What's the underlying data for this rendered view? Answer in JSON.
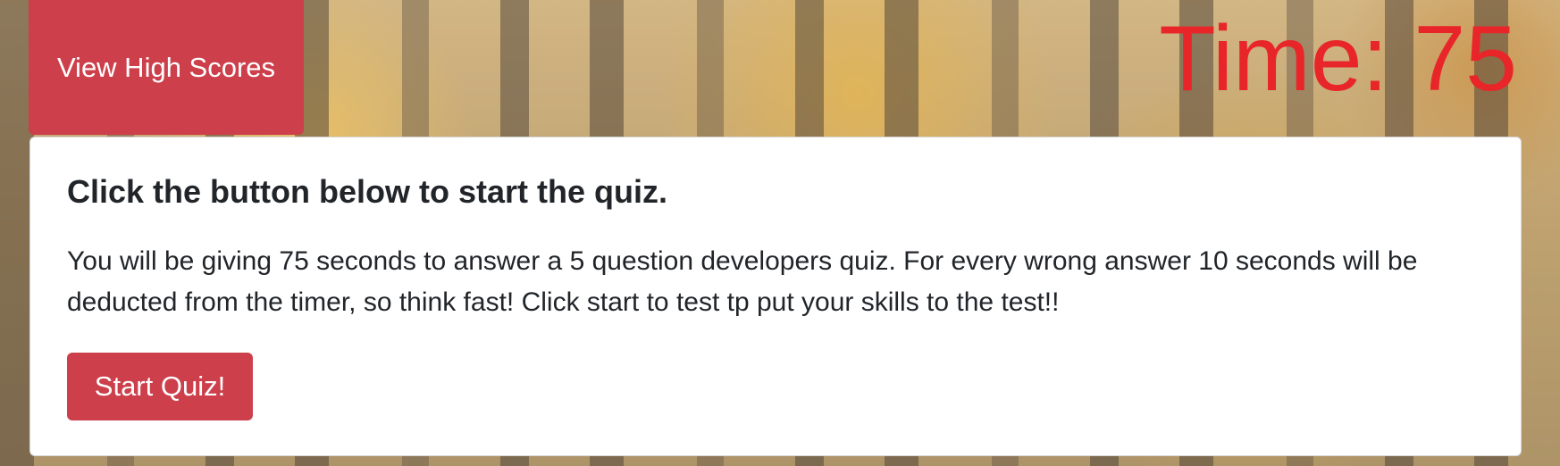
{
  "header": {
    "high_scores_label": "View High Scores",
    "timer_text": "Time: 75"
  },
  "card": {
    "title": "Click the button below to start the quiz.",
    "description": "You will be giving 75 seconds to answer a 5 question developers quiz. For every wrong answer 10 seconds will be deducted from the timer, so think fast! Click start to test tp put your skills to the test!!",
    "start_label": "Start Quiz!"
  },
  "colors": {
    "button_red": "#cc3f4b",
    "timer_red": "#e8262a",
    "text_dark": "#212529"
  }
}
